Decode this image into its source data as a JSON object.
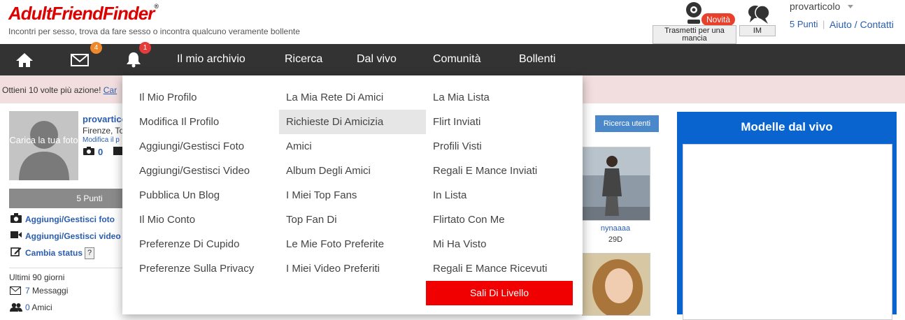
{
  "header": {
    "logo_text": "AdultFriendFinder",
    "logo_mark": "®",
    "tagline": "Incontri per sesso, trova da fare sesso o incontra qualcuno veramente bollente",
    "broadcast_label": "Trasmetti per una mancia",
    "novita_badge": "Novità",
    "im_label": "IM",
    "username": "provarticolo",
    "points": "5 Punti",
    "separator": "|",
    "help": "Aiuto / Contatti"
  },
  "nav": {
    "mail_count": "4",
    "bell_count": "1",
    "items": [
      "Il mio archivio",
      "Ricerca",
      "Dal vivo",
      "Comunità",
      "Bollenti"
    ]
  },
  "promo": {
    "text": "Ottieni 10 volte più azione!",
    "link": "Car"
  },
  "profile": {
    "upload_photo": "Carica la tua foto",
    "name": "provartico",
    "location": "Firenze, To",
    "edit": "Modifica il p",
    "photo_count": "0",
    "points_bar": "5 Punti",
    "links": [
      "Aggiungi/Gestisci foto",
      "Aggiungi/Gestisci video",
      "Cambia status"
    ],
    "help_q": "?",
    "last_days": "Ultimi 90 giorni",
    "messages_count": "7",
    "messages_label": "Messaggi",
    "friends_count": "0",
    "friends_label": "Amici"
  },
  "content": {
    "search_users": "Ricerca utenti",
    "thumb1_name": "nynaaaa",
    "thumb1_age": "29D"
  },
  "live": {
    "title": "Modelle dal vivo"
  },
  "dropdown": {
    "col1": [
      "Il Mio Profilo",
      "Modifica Il Profilo",
      "Aggiungi/Gestisci Foto",
      "Aggiungi/Gestisci Video",
      "Pubblica Un Blog",
      "Il Mio Conto",
      "Preferenze Di Cupido",
      "Preferenze Sulla Privacy"
    ],
    "col2": [
      "La Mia Rete Di Amici",
      "Richieste Di Amicizia",
      "Amici",
      "Album Degli Amici",
      "I Miei Top Fans",
      "Top Fan Di",
      "Le Mie Foto Preferite",
      "I Miei Video Preferiti"
    ],
    "col3": [
      "La Mia Lista",
      "Flirt Inviati",
      "Profili Visti",
      "Regali E Mance Inviati",
      "In Lista",
      "Flirtato Con Me",
      "Mi Ha Visto",
      "Regali E Mance Ricevuti"
    ],
    "upgrade": "Sali Di Livello",
    "highlighted": "Richieste Di Amicizia"
  }
}
